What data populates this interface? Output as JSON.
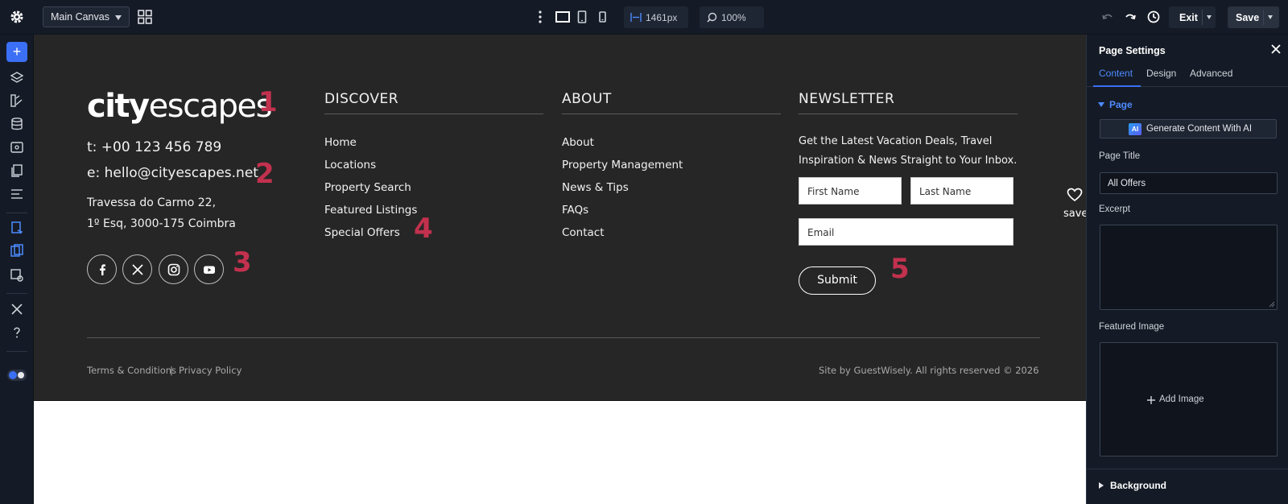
{
  "toolbar": {
    "canvas_select": "Main Canvas",
    "width_value": "1461px",
    "zoom_value": "100%",
    "exit_label": "Exit",
    "save_label": "Save"
  },
  "site": {
    "logo_bold": "city",
    "logo_light": "escapes",
    "phone": "t: +00 123 456 789",
    "email": "e: hello@cityescapes.net",
    "address_line1": "Travessa do Carmo 22,",
    "address_line2": "1º Esq, 3000-175 Coimbra",
    "markers": [
      "1",
      "2",
      "3",
      "4",
      "5"
    ],
    "discover": {
      "title": "DISCOVER",
      "links": [
        "Home",
        "Locations",
        "Property Search",
        "Featured Listings",
        "Special Offers"
      ]
    },
    "about": {
      "title": "ABOUT",
      "links": [
        "About",
        "Property Management",
        "News & Tips",
        "FAQs",
        "Contact"
      ]
    },
    "newsletter": {
      "title": "NEWSLETTER",
      "text_line1": "Get the Latest Vacation Deals, Travel",
      "text_line2": "Inspiration & News Straight to Your Inbox.",
      "first_name_placeholder": "First Name",
      "last_name_placeholder": "Last Name",
      "email_placeholder": "Email",
      "submit_label": "Submit"
    },
    "save_label": "save",
    "terms": "Terms & Conditions",
    "separator": "|",
    "privacy": "Privacy Policy",
    "credit": "Site by GuestWisely. All rights reserved © 2026"
  },
  "panel": {
    "title": "Page Settings",
    "tabs": [
      "Content",
      "Design",
      "Advanced"
    ],
    "section": "Page",
    "generate_label": "Generate Content With AI",
    "ai_badge": "AI",
    "page_title_label": "Page Title",
    "page_title_value": "All Offers",
    "excerpt_label": "Excerpt",
    "featured_image_label": "Featured Image",
    "add_image_label": "Add Image",
    "background_label": "Background"
  },
  "colors": {
    "accent": "#3b6ff5",
    "marker": "#c2314e",
    "footer_bg": "#262626"
  }
}
